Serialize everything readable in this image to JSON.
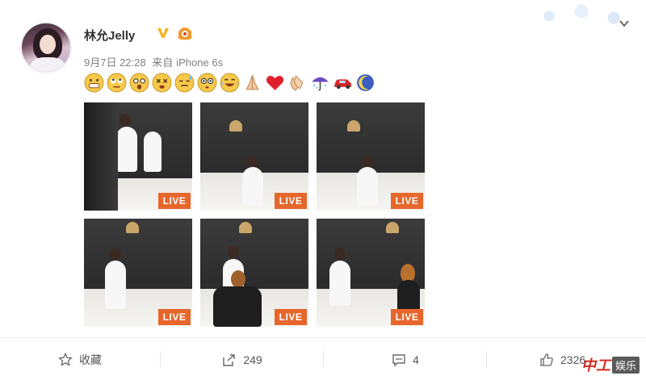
{
  "post": {
    "author": "林允Jelly",
    "date": "9月7日 22:28",
    "source_prefix": "来自",
    "source_device": "iPhone 6s",
    "emojis": [
      "grin",
      "roll-eyes",
      "astonished",
      "dizzy",
      "sweat",
      "flushed",
      "cry-laugh",
      "pray",
      "heart",
      "clap",
      "umbrella-rain",
      "car",
      "moon"
    ],
    "photos": [
      {
        "badge": "LIVE"
      },
      {
        "badge": "LIVE"
      },
      {
        "badge": "LIVE"
      },
      {
        "badge": "LIVE"
      },
      {
        "badge": "LIVE"
      },
      {
        "badge": "LIVE"
      }
    ]
  },
  "actions": {
    "favorite_label": "收藏",
    "repost_count": "249",
    "comment_count": "4",
    "like_count": "2326"
  },
  "watermark": {
    "text_a": "中工",
    "text_b": "娱乐"
  },
  "colors": {
    "live_badge": "#e6662b",
    "verified": "#f6b21b"
  }
}
